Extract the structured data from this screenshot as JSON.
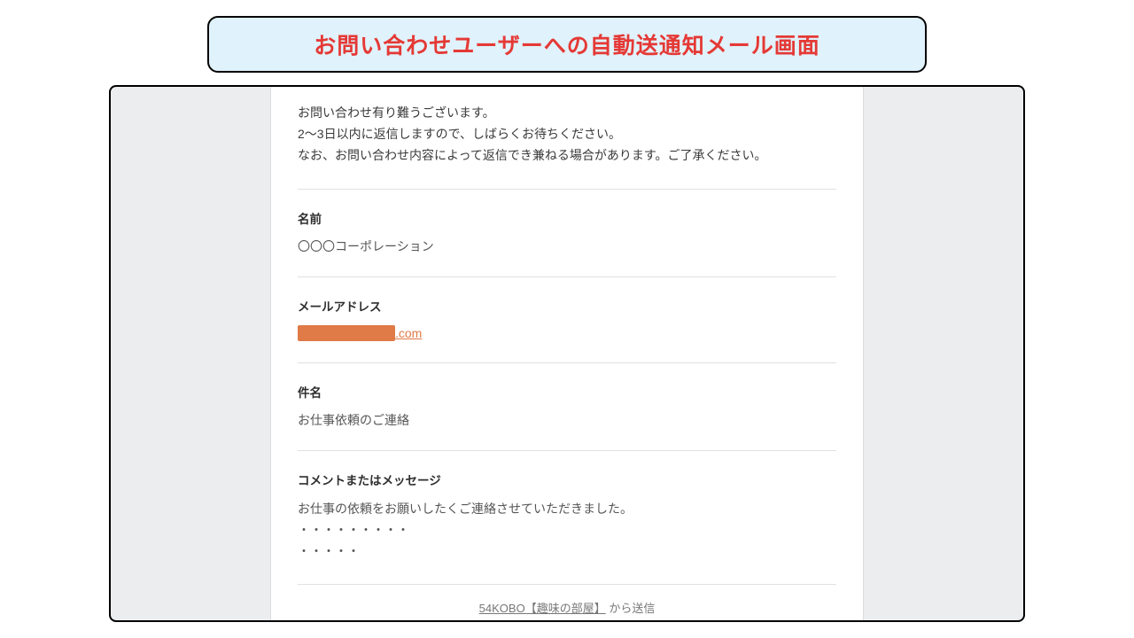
{
  "header": {
    "title": "お問い合わせユーザーへの自動送通知メール画面"
  },
  "intro": {
    "line1": "お問い合わせ有り難うございます。",
    "line2": "2～3日以内に返信しますので、しばらくお待ちください。",
    "line3": "なお、お問い合わせ内容によって返信でき兼ねる場合があります。ご了承ください。"
  },
  "fields": {
    "name_label": "名前",
    "name_value": "〇〇〇コーポレーション",
    "email_label": "メールアドレス",
    "email_suffix": ".com",
    "subject_label": "件名",
    "subject_value": "お仕事依頼のご連絡",
    "message_label": "コメントまたはメッセージ",
    "message_line1": "お仕事の依頼をお願いしたくご連絡させていただきました。",
    "message_line2": "・・・・・・・・・",
    "message_line3": "・・・・・"
  },
  "footer": {
    "link_text": "54KOBO【趣味の部屋】",
    "suffix": " から送信"
  }
}
